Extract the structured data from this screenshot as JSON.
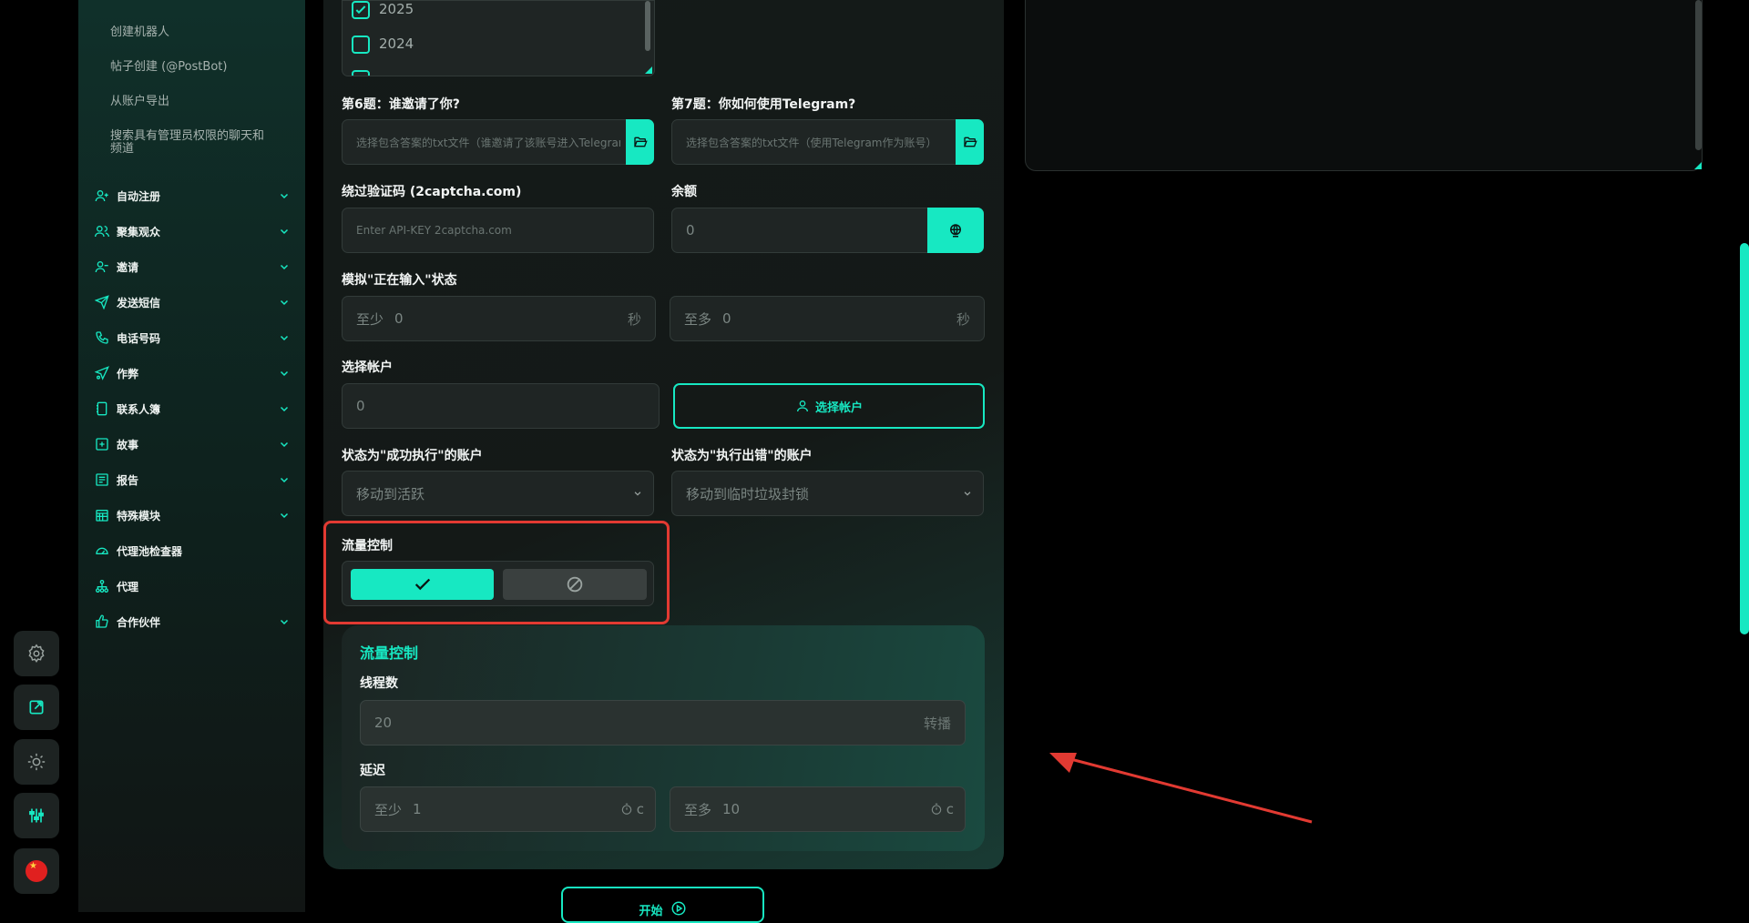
{
  "sidebar": {
    "sub_items": [
      "创建机器人",
      "帖子创建 (@PostBot)",
      "从账户导出",
      "搜索具有管理员权限的聊天和频道"
    ],
    "nav_items": [
      {
        "label": "自动注册",
        "icon": "user-plus-icon",
        "expandable": true
      },
      {
        "label": "聚集观众",
        "icon": "users-icon",
        "expandable": true
      },
      {
        "label": "邀请",
        "icon": "user-add-icon",
        "expandable": true
      },
      {
        "label": "发送短信",
        "icon": "send-icon",
        "expandable": true
      },
      {
        "label": "电话号码",
        "icon": "phone-icon",
        "expandable": true
      },
      {
        "label": "作弊",
        "icon": "paper-plane-icon",
        "expandable": true
      },
      {
        "label": "联系人簿",
        "icon": "contacts-icon",
        "expandable": true
      },
      {
        "label": "故事",
        "icon": "plus-square-icon",
        "expandable": true
      },
      {
        "label": "报告",
        "icon": "report-icon",
        "expandable": true
      },
      {
        "label": "特殊模块",
        "icon": "calendar-icon",
        "expandable": true
      },
      {
        "label": "代理池检查器",
        "icon": "gauge-icon",
        "expandable": false
      },
      {
        "label": "代理",
        "icon": "network-icon",
        "expandable": false
      },
      {
        "label": "合作伙伴",
        "icon": "thumb-up-icon",
        "expandable": true
      }
    ]
  },
  "rail": {
    "buttons": [
      "gear-icon",
      "external-link-icon",
      "sun-icon",
      "sliders-icon",
      "china-flag-icon"
    ],
    "active": "sliders-icon"
  },
  "years": [
    {
      "label": "2025",
      "checked": true
    },
    {
      "label": "2024",
      "checked": false
    }
  ],
  "form": {
    "q6_label": "第6题：谁邀请了你?",
    "q6_placeholder": "选择包含答案的txt文件（谁邀请了该账号进入Telegram?）",
    "q7_label": "第7题：你如何使用Telegram?",
    "q7_placeholder": "选择包含答案的txt文件（使用Telegram作为账号）",
    "captcha_label": "绕过验证码 (2captcha.com)",
    "captcha_placeholder": "Enter API-KEY 2captcha.com",
    "balance_label": "余额",
    "balance_value": "0",
    "typing_label": "模拟\"正在输入\"状态",
    "typing_min_prefix": "至少",
    "typing_min_value": "0",
    "typing_min_unit": "秒",
    "typing_max_prefix": "至多",
    "typing_max_value": "0",
    "typing_max_unit": "秒",
    "accounts_label": "选择帐户",
    "accounts_value": "0",
    "accounts_button": "选择帐户",
    "success_label": "状态为\"成功执行\"的账户",
    "success_value": "移动到活跃",
    "error_label": "状态为\"执行出错\"的账户",
    "error_value": "移动到临时垃圾封锁",
    "flow_label": "流量控制",
    "flow_enabled": true
  },
  "flow_card": {
    "title": "流量控制",
    "threads_label": "线程数",
    "threads_value": "20",
    "threads_unit": "转播",
    "delay_label": "延迟",
    "delay_min_prefix": "至少",
    "delay_min_value": "1",
    "delay_max_prefix": "至多",
    "delay_max_value": "10",
    "delay_unit": "c"
  },
  "start_button": "开始",
  "colors": {
    "accent": "#17e8c2",
    "highlight": "#e23a32",
    "background": "#000000",
    "panel": "#141a19"
  }
}
